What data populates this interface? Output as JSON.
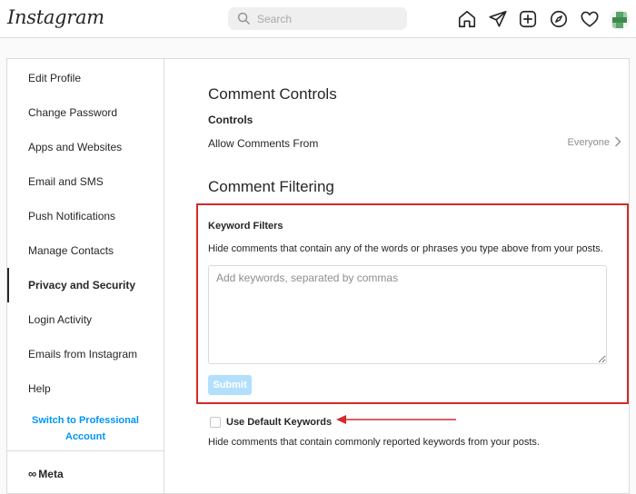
{
  "topbar": {
    "logo": "Instagram",
    "search_placeholder": "Search",
    "icons": [
      "home-icon",
      "direct-message-icon",
      "new-post-icon",
      "explore-icon",
      "activity-heart-icon",
      "profile-avatar"
    ]
  },
  "sidebar": {
    "items": [
      {
        "label": "Edit Profile",
        "active": false
      },
      {
        "label": "Change Password",
        "active": false
      },
      {
        "label": "Apps and Websites",
        "active": false
      },
      {
        "label": "Email and SMS",
        "active": false
      },
      {
        "label": "Push Notifications",
        "active": false
      },
      {
        "label": "Manage Contacts",
        "active": false
      },
      {
        "label": "Privacy and Security",
        "active": true
      },
      {
        "label": "Login Activity",
        "active": false
      },
      {
        "label": "Emails from Instagram",
        "active": false
      },
      {
        "label": "Help",
        "active": false
      }
    ],
    "switch_line1": "Switch to Professional",
    "switch_line2": "Account",
    "meta_label": "Meta"
  },
  "main": {
    "comment_controls_title": "Comment Controls",
    "controls_label": "Controls",
    "allow_comments_label": "Allow Comments From",
    "allow_comments_value": "Everyone",
    "comment_filtering_title": "Comment Filtering",
    "keyword_filters_title": "Keyword Filters",
    "keyword_filters_desc": "Hide comments that contain any of the words or phrases you type above from your posts.",
    "keyword_placeholder": "Add keywords, separated by commas",
    "submit_label": "Submit",
    "default_keywords_label": "Use Default Keywords",
    "default_keywords_checked": false,
    "default_keywords_desc": "Hide comments that contain commonly reported keywords from your posts."
  },
  "colors": {
    "accent": "#0095f6",
    "submit_disabled": "#b2dffc",
    "annotation_red": "#d42a2a"
  }
}
